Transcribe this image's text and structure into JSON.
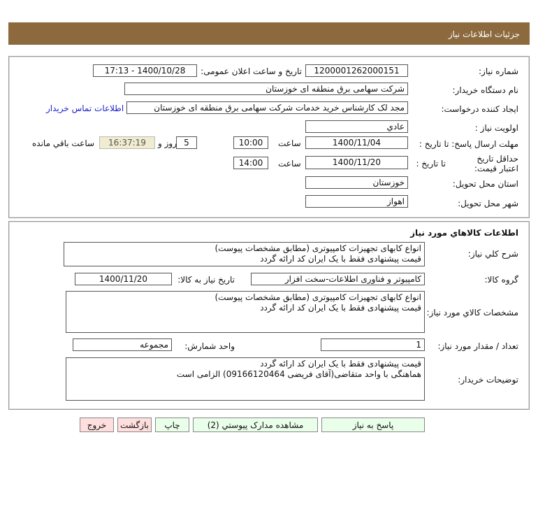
{
  "header": {
    "title": "جزئیات اطلاعات نیاز"
  },
  "info": {
    "need_number_label": "شماره نیاز:",
    "need_number": "1200001262000151",
    "announce_label": "تاریخ و ساعت اعلان عمومی:",
    "announce_value": "1400/10/28 - 17:13",
    "buyer_label": "نام دستگاه خریدار:",
    "buyer": "شرکت سهامی برق منطقه ای خوزستان",
    "creator_label": "ایجاد کننده درخواست:",
    "creator": "مجد لک کارشناس خرید خدمات شرکت سهامی برق منطقه ای خوزستان",
    "contact_link": "اطلاعات تماس خریدار",
    "priority_label": "اولویت نیاز :",
    "priority": "عادي",
    "deadline_label": "مهلت ارسال پاسخ: تا تاریخ :",
    "deadline_date": "1400/11/04",
    "time_label": "ساعت",
    "deadline_time": "10:00",
    "days": "5",
    "days_label": "روز و",
    "remaining": "16:37:19",
    "remaining_label": "ساعت باقي مانده",
    "validity_label": "حداقل تاریخ اعتبار قیمت:",
    "validity_to": "تا تاریخ :",
    "validity_date": "1400/11/20",
    "validity_time": "14:00",
    "province_label": "استان محل تحویل:",
    "province": "خوزستان",
    "city_label": "شهر محل تحویل:",
    "city": "اهواز"
  },
  "goods": {
    "title": "اطلاعات کالاهاي مورد نياز",
    "summary_label": "شرح کلي نياز:",
    "summary": "انواع کابهای تجهیزات کامپیوتری (مطابق مشخصات پیوست)\nقیمت پیشنهادی فقط با یک ایران کد ارائه گردد",
    "group_label": "گروه کالا:",
    "group": "کامپیوتر و فناوری اطلاعات-سخت افزار",
    "need_date_label": "تاریخ نیاز به کالا:",
    "need_date": "1400/11/20",
    "specs_label": "مشخصات کالاي مورد نياز:",
    "specs": "انواع کابهای تجهیزات کامپیوتری (مطابق مشخصات پیوست)\nقیمت پیشنهادی فقط با یک ایران کد ارائه گردد",
    "qty_label": "تعداد / مقدار مورد نياز:",
    "qty": "1",
    "unit_label": "واحد شمارش:",
    "unit": "مجموعه",
    "notes_label": "توضیحات خریدار:",
    "notes": "قیمت پیشنهادی فقط با یک ایران کد ارائه گردد\nهماهنگی با واحد متقاضی(آقای فریضی 09166120464) الزامی است"
  },
  "buttons": {
    "reply": "پاسخ به نیاز",
    "attachments": "مشاهده مدارک پیوستي (2)",
    "print": "چاپ",
    "back": "بازگشت",
    "exit": "خروج"
  }
}
